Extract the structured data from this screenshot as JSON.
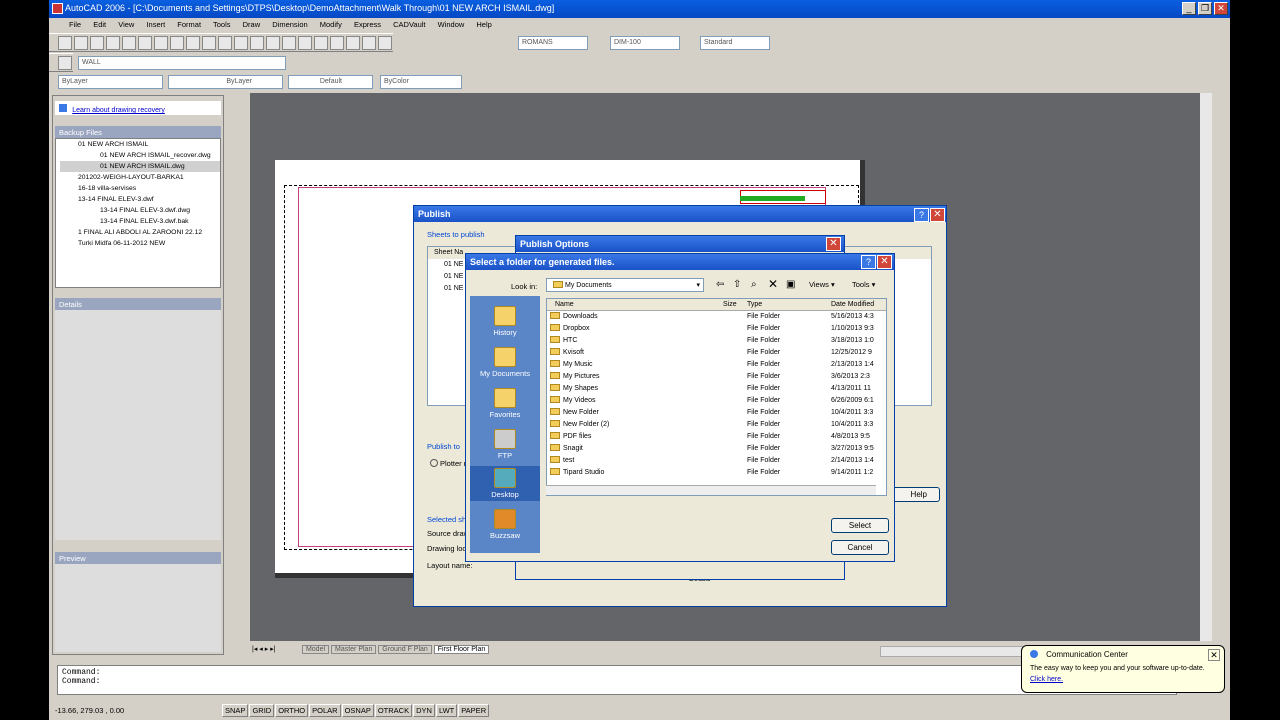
{
  "app": {
    "title": "AutoCAD 2006 - [C:\\Documents and Settings\\DTPS\\Desktop\\DemoAttachment\\Walk Through\\01 NEW ARCH ISMAIL.dwg]"
  },
  "menu": [
    "File",
    "Edit",
    "View",
    "Insert",
    "Format",
    "Tools",
    "Draw",
    "Dimension",
    "Modify",
    "Express",
    "CADVault",
    "Window",
    "Help"
  ],
  "toolbar": {
    "text_style": "ROMANS",
    "dim_style": "DIM-100",
    "table_style": "Standard",
    "layer": "WALL",
    "color": "ByLayer",
    "linetype": "ByLayer",
    "lineweight": "Default",
    "plotstyle": "ByColor"
  },
  "recovery": {
    "link": "Learn about drawing recovery",
    "backup_header": "Backup Files",
    "items": [
      "01 NEW ARCH ISMAIL",
      "01 NEW ARCH ISMAIL_recover.dwg",
      "01 NEW ARCH ISMAIL.dwg",
      "201202-WEIGH-LAYOUT-BARKA1",
      "16-18 villa-servises",
      "13-14 FINAL ELEV-3.dwf",
      "13-14 FINAL ELEV-3.dwf.dwg",
      "13-14 FINAL ELEV-3.dwf.bak",
      "1 FINAL ALI ABDOLI AL ZAROONI 22.12",
      "Turki Midfa 06-11-2012 NEW"
    ],
    "details_header": "Details",
    "preview_header": "Preview"
  },
  "publish": {
    "title": "Publish",
    "sheets_label": "Sheets to publish",
    "col_sheet": "Sheet Na",
    "rows": [
      "01 NE",
      "01 NE",
      "01 NE"
    ],
    "publish_to": "Publish to",
    "plotter": "Plotter n",
    "selected": "Selected sh",
    "source": "Source draw",
    "drawing_loc": "Drawing loc",
    "layout_name": "Layout name:",
    "help": "Help",
    "details": "Details"
  },
  "options": {
    "title": "Publish Options"
  },
  "folder": {
    "title": "Select a folder for generated files.",
    "look_in_label": "Look in:",
    "look_in": "My Documents",
    "views": "Views",
    "tools": "Tools",
    "places": [
      "History",
      "My Documents",
      "Favorites",
      "FTP",
      "Desktop",
      "Buzzsaw"
    ],
    "headers": {
      "name": "Name",
      "size": "Size",
      "type": "Type",
      "date": "Date Modified"
    },
    "files": [
      {
        "name": "Downloads",
        "type": "File Folder",
        "date": "5/16/2013 4:3"
      },
      {
        "name": "Dropbox",
        "type": "File Folder",
        "date": "1/10/2013 9:3"
      },
      {
        "name": "HTC",
        "type": "File Folder",
        "date": "3/18/2013 1:0"
      },
      {
        "name": "Kvisoft",
        "type": "File Folder",
        "date": "12/25/2012 9"
      },
      {
        "name": "My Music",
        "type": "File Folder",
        "date": "2/13/2013 1:4"
      },
      {
        "name": "My Pictures",
        "type": "File Folder",
        "date": "3/6/2013 2:3"
      },
      {
        "name": "My Shapes",
        "type": "File Folder",
        "date": "4/13/2011 11"
      },
      {
        "name": "My Videos",
        "type": "File Folder",
        "date": "6/26/2009 6:1"
      },
      {
        "name": "New Folder",
        "type": "File Folder",
        "date": "10/4/2011 3:3"
      },
      {
        "name": "New Folder (2)",
        "type": "File Folder",
        "date": "10/4/2011 3:3"
      },
      {
        "name": "PDF files",
        "type": "File Folder",
        "date": "4/8/2013 9:5"
      },
      {
        "name": "Snagit",
        "type": "File Folder",
        "date": "3/27/2013 9:5"
      },
      {
        "name": "test",
        "type": "File Folder",
        "date": "2/14/2013 1:4"
      },
      {
        "name": "Tipard Studio",
        "type": "File Folder",
        "date": "9/14/2011 1:2"
      }
    ],
    "select": "Select",
    "cancel": "Cancel"
  },
  "tabs": [
    "Model",
    "Master Plan",
    "Ground F Plan",
    "First Floor Plan"
  ],
  "command": {
    "line1": "Command:",
    "line2": "Command:"
  },
  "status": {
    "coords": "-13.66, 279.03 , 0.00",
    "buttons": [
      "SNAP",
      "GRID",
      "ORTHO",
      "POLAR",
      "OSNAP",
      "OTRACK",
      "DYN",
      "LWT",
      "PAPER"
    ]
  },
  "comm": {
    "title": "Communication Center",
    "body": "The easy way to keep you and your software up-to-date.",
    "link": "Click here."
  }
}
